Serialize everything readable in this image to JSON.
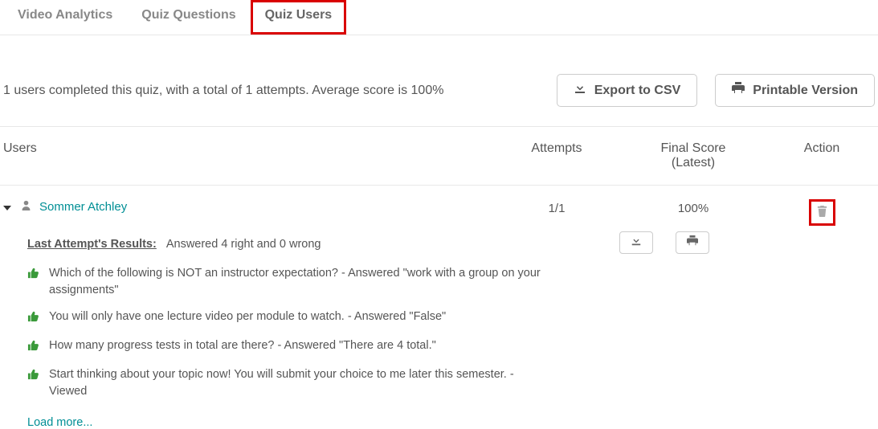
{
  "tabs": {
    "video_analytics": "Video Analytics",
    "quiz_questions": "Quiz Questions",
    "quiz_users": "Quiz Users"
  },
  "summary": "1 users completed this quiz, with a total of 1 attempts. Average score is 100%",
  "buttons": {
    "export_csv": "Export to CSV",
    "printable": "Printable Version"
  },
  "headers": {
    "users": "Users",
    "attempts": "Attempts",
    "final_score_line1": "Final Score",
    "final_score_line2": "(Latest)",
    "action": "Action"
  },
  "row": {
    "user_name": "Sommer Atchley",
    "attempts": "1/1",
    "score": "100%"
  },
  "details": {
    "last_label": "Last Attempt's Results:",
    "summary": "Answered 4 right and 0 wrong",
    "questions": [
      "Which of the following is NOT an instructor expectation? - Answered \"work with a group on your assignments\"",
      "You will only have one lecture video per module to watch. - Answered \"False\"",
      "How many progress tests in total are there? - Answered \"There are 4 total.\"",
      "Start thinking about your topic now! You will submit your choice to me later this semester. - Viewed"
    ],
    "load_more": "Load more..."
  },
  "icons": {
    "download": "download-icon",
    "print": "print-icon",
    "trash": "trash-icon",
    "caret": "caret-down-icon",
    "user": "user-icon",
    "thumb": "thumbs-up-icon"
  }
}
